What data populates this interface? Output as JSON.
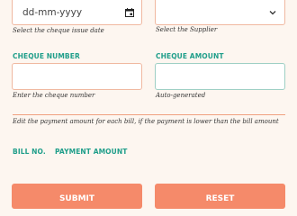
{
  "cheque_date": {
    "value": "dd-mm-yyyy",
    "hint": "Select the cheque issue date"
  },
  "supplier": {
    "value": "",
    "hint": "Select the Supplier"
  },
  "cheque_number": {
    "label": "CHEQUE NUMBER",
    "value": "",
    "hint": "Enter the cheque number"
  },
  "cheque_amount": {
    "label": "CHEQUE AMOUNT",
    "value": "",
    "hint": "Auto-generated"
  },
  "payment_note": "Edit the payment amount for each bill, if the payment is lower than the bill amount",
  "bills_table": {
    "columns": [
      "BILL NO.",
      "PAYMENT AMOUNT"
    ]
  },
  "buttons": {
    "submit": "SUBMIT",
    "reset": "RESET"
  },
  "colors": {
    "accent": "#f58a6a",
    "label": "#1f9e8a",
    "background": "#fdf6f0"
  },
  "icons": {
    "date_picker": "calendar-icon",
    "supplier_dropdown": "chevron-down-icon"
  }
}
